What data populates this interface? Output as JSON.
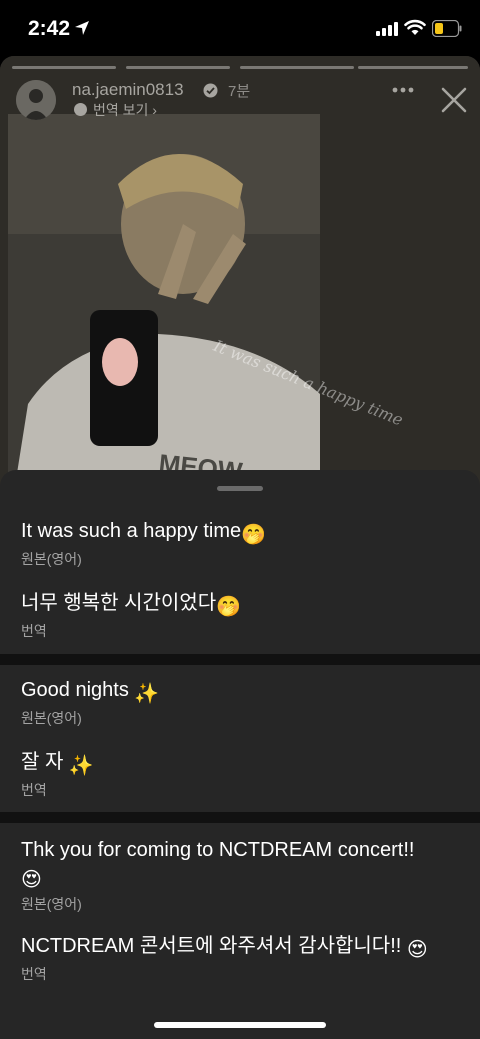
{
  "status_bar": {
    "time": "2:42"
  },
  "story": {
    "username": "na.jaemin0813",
    "time_ago": "7분",
    "translate_link": "번역 보기",
    "overlay_text": "It was such a happy time"
  },
  "translations": [
    {
      "text": "It was such a happy time",
      "emoji": "🤭",
      "label": "원본(영어)"
    },
    {
      "text": "너무 행복한 시간이었다",
      "emoji": "🤭",
      "label": "번역"
    },
    {
      "text": "Good nights ",
      "emoji": "✨",
      "label": "원본(영어)"
    },
    {
      "text": "잘 자 ",
      "emoji": "✨",
      "label": "번역"
    },
    {
      "text": "Thk you for coming to NCTDREAM concert!!",
      "emoji": "😍",
      "label": "원본(영어)"
    },
    {
      "text": "NCTDREAM 콘서트에 와주셔서 감사합니다!! ",
      "emoji": "😍",
      "label": "번역"
    }
  ],
  "icons": {
    "location": "location-arrow-icon",
    "signal": "cellular-signal-icon",
    "wifi": "wifi-icon",
    "battery": "battery-icon",
    "verified": "verified-badge-icon",
    "more": "more-options-icon",
    "close": "close-icon"
  },
  "colors": {
    "sheet_bg": "#262626",
    "divider": "#111111",
    "label": "#a3a3a3"
  }
}
